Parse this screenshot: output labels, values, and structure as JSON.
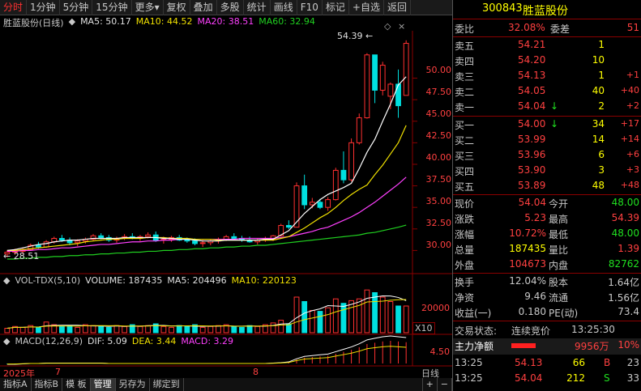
{
  "toolbar": {
    "items": [
      "分时",
      "1分钟",
      "5分钟",
      "15分钟",
      "更多",
      "复权",
      "叠加",
      "多股",
      "统计",
      "画线",
      "F10",
      "标记",
      "+自选",
      "返回"
    ],
    "more_arrow": "▾"
  },
  "chart_header": {
    "stock_name": "胜蓝股份(日线)",
    "ma5_label": "MA5: 50.17",
    "ma10_label": "MA10: 44.52",
    "ma20_label": "MA20: 38.51",
    "ma60_label": "MA60: 32.94"
  },
  "price_axis": [
    "50.00",
    "47.50",
    "45.00",
    "42.50",
    "40.00",
    "37.50",
    "35.00",
    "32.50",
    "30.00"
  ],
  "annotations": {
    "high": "54.39",
    "low": "28.51"
  },
  "volume_header": {
    "indicator": "VOL-TDX(5,10)",
    "volume": "VOLUME: 187435",
    "ma5": "MA5: 204496",
    "ma10": "MA10: 220123"
  },
  "volume_axis": [
    "20000"
  ],
  "volume_unit": "X10",
  "macd_header": {
    "indicator": "MACD(12,26,9)",
    "dif": "DIF: 5.09",
    "dea": "DEA: 3.44",
    "macd": "MACD: 3.29"
  },
  "macd_axis": [
    "4.50"
  ],
  "time_axis": {
    "year": "2025年",
    "m7": "7",
    "m8": "8",
    "period": "日线"
  },
  "bottom_tabs": [
    "指标A",
    "指标B",
    "模 板",
    "管理",
    "另存为",
    "绑定到"
  ],
  "bottom_controls": [
    "+",
    "−"
  ],
  "quote": {
    "code": "300843",
    "name": "胜蓝股份",
    "weibi_label": "委比",
    "weibi_value": "32.08%",
    "weicha_label": "委差",
    "weicha_value": "51",
    "asks": [
      {
        "label": "卖五",
        "price": "54.21",
        "vol": "1",
        "chg": ""
      },
      {
        "label": "卖四",
        "price": "54.20",
        "vol": "10",
        "chg": ""
      },
      {
        "label": "卖三",
        "price": "54.13",
        "vol": "1",
        "chg": "+1"
      },
      {
        "label": "卖二",
        "price": "54.05",
        "vol": "40",
        "chg": "+40"
      },
      {
        "label": "卖一",
        "price": "54.04",
        "vol": "2",
        "chg": "+2"
      }
    ],
    "bids": [
      {
        "label": "买一",
        "price": "54.00",
        "vol": "34",
        "chg": "+17"
      },
      {
        "label": "买二",
        "price": "53.99",
        "vol": "14",
        "chg": "+14"
      },
      {
        "label": "买三",
        "price": "53.96",
        "vol": "6",
        "chg": "+6"
      },
      {
        "label": "买四",
        "price": "53.90",
        "vol": "3",
        "chg": "+3"
      },
      {
        "label": "买五",
        "price": "53.89",
        "vol": "48",
        "chg": "+48"
      }
    ],
    "stats": [
      {
        "l1": "现价",
        "v1": "54.04",
        "l2": "今开",
        "v2": "48.00"
      },
      {
        "l1": "涨跌",
        "v1": "5.23",
        "l2": "最高",
        "v2": "54.39"
      },
      {
        "l1": "涨幅",
        "v1": "10.72%",
        "l2": "最低",
        "v2": "48.00"
      },
      {
        "l1": "总量",
        "v1": "187435",
        "l2": "量比",
        "v2": "1.39"
      },
      {
        "l1": "外盘",
        "v1": "104673",
        "l2": "内盘",
        "v2": "82762"
      }
    ],
    "stats2": [
      {
        "l1": "换手",
        "v1": "12.04%",
        "l2": "股本",
        "v2": "1.64亿"
      },
      {
        "l1": "净资",
        "v1": "9.46",
        "l2": "流通",
        "v2": "1.56亿"
      },
      {
        "l1": "收益(一)",
        "v1": "0.180",
        "l2": "PE(动)",
        "v2": "73.4"
      }
    ],
    "trade_status_label": "交易状态:",
    "trade_status": "连续竞价",
    "trade_time": "13:25:30",
    "main_flow_label": "主力净额",
    "main_flow_value": "9956万",
    "main_flow_pct": "10%",
    "ticks": [
      {
        "time": "13:25",
        "price": "54.13",
        "vol": "66",
        "side": "B",
        "n": "23"
      },
      {
        "time": "13:25",
        "price": "54.04",
        "vol": "212",
        "side": "S",
        "n": "33"
      }
    ]
  },
  "chart_data": {
    "type": "candlestick",
    "ylim": [
      27.5,
      55.5
    ],
    "candles": [
      [
        29.6,
        30.0,
        29.2,
        29.8
      ],
      [
        29.8,
        30.2,
        29.5,
        29.9
      ],
      [
        29.9,
        30.3,
        29.6,
        30.1
      ],
      [
        30.1,
        30.8,
        30.0,
        30.6
      ],
      [
        30.6,
        31.0,
        30.2,
        30.4
      ],
      [
        30.4,
        31.2,
        30.3,
        31.0
      ],
      [
        31.0,
        31.6,
        30.8,
        31.4
      ],
      [
        31.4,
        31.8,
        31.0,
        31.2
      ],
      [
        31.2,
        31.5,
        30.6,
        30.9
      ],
      [
        30.9,
        31.3,
        30.5,
        31.1
      ],
      [
        31.1,
        31.5,
        30.8,
        31.3
      ],
      [
        31.3,
        31.9,
        31.1,
        31.7
      ],
      [
        31.7,
        32.0,
        31.3,
        31.5
      ],
      [
        31.5,
        31.8,
        31.0,
        31.2
      ],
      [
        31.2,
        31.6,
        30.9,
        31.4
      ],
      [
        31.4,
        31.9,
        31.2,
        31.6
      ],
      [
        31.6,
        32.0,
        31.3,
        31.4
      ],
      [
        31.4,
        31.8,
        31.1,
        31.6
      ],
      [
        31.6,
        32.1,
        31.4,
        31.8
      ],
      [
        31.8,
        32.2,
        31.0,
        31.2
      ],
      [
        31.2,
        31.6,
        30.8,
        31.3
      ],
      [
        31.3,
        31.7,
        31.0,
        31.5
      ],
      [
        31.5,
        31.8,
        31.1,
        31.2
      ],
      [
        31.2,
        31.5,
        30.9,
        31.1
      ],
      [
        31.1,
        31.4,
        30.6,
        30.8
      ],
      [
        30.8,
        31.2,
        30.4,
        30.9
      ],
      [
        30.9,
        31.3,
        30.6,
        31.1
      ],
      [
        31.1,
        31.5,
        30.8,
        31.3
      ],
      [
        31.3,
        31.8,
        31.1,
        31.6
      ],
      [
        31.6,
        32.0,
        31.2,
        31.4
      ],
      [
        31.4,
        31.7,
        31.0,
        31.2
      ],
      [
        31.2,
        31.6,
        30.9,
        31.0
      ],
      [
        31.0,
        31.4,
        30.7,
        31.2
      ],
      [
        31.2,
        31.6,
        31.0,
        31.3
      ],
      [
        31.3,
        31.8,
        31.1,
        31.7
      ],
      [
        31.7,
        33.1,
        31.6,
        32.9
      ],
      [
        32.9,
        33.5,
        32.5,
        32.7
      ],
      [
        32.7,
        37.9,
        32.7,
        37.5
      ],
      [
        37.5,
        38.8,
        34.8,
        35.3
      ],
      [
        35.3,
        36.1,
        34.9,
        35.6
      ],
      [
        35.6,
        36.0,
        34.8,
        35.0
      ],
      [
        35.0,
        36.2,
        34.6,
        35.9
      ],
      [
        35.9,
        39.6,
        35.8,
        39.3
      ],
      [
        39.3,
        41.5,
        37.8,
        38.2
      ],
      [
        38.2,
        43.0,
        38.0,
        42.5
      ],
      [
        42.5,
        45.9,
        42.3,
        45.4
      ],
      [
        45.4,
        52.9,
        45.3,
        52.7
      ],
      [
        52.7,
        52.7,
        47.1,
        48.6
      ],
      [
        48.6,
        51.9,
        48.0,
        51.5
      ],
      [
        47.9,
        49.5,
        46.4,
        49.3
      ],
      [
        49.3,
        51.0,
        45.4,
        46.8
      ],
      [
        48.0,
        54.39,
        48.0,
        54.04
      ]
    ],
    "ma5": [
      30.0,
      30.1,
      30.3,
      30.5,
      30.7,
      30.8,
      31.0,
      31.1,
      31.2,
      31.2,
      31.3,
      31.4,
      31.4,
      31.4,
      31.4,
      31.5,
      31.5,
      31.5,
      31.5,
      31.5,
      31.4,
      31.4,
      31.3,
      31.3,
      31.2,
      31.1,
      31.1,
      31.1,
      31.2,
      31.2,
      31.2,
      31.2,
      31.2,
      31.3,
      31.3,
      31.8,
      32.3,
      33.3,
      34.3,
      35.1,
      35.9,
      36.5,
      36.9,
      37.3,
      37.8,
      39.5,
      41.4,
      42.9,
      45.0,
      47.0,
      49.2,
      50.17
    ],
    "ma10": [
      30.0,
      30.0,
      30.1,
      30.2,
      30.3,
      30.4,
      30.5,
      30.6,
      30.7,
      30.8,
      31.0,
      31.1,
      31.2,
      31.3,
      31.3,
      31.4,
      31.4,
      31.4,
      31.5,
      31.5,
      31.5,
      31.4,
      31.4,
      31.4,
      31.3,
      31.3,
      31.3,
      31.2,
      31.2,
      31.2,
      31.2,
      31.2,
      31.2,
      31.2,
      31.2,
      31.4,
      31.6,
      32.1,
      32.6,
      33.2,
      33.8,
      34.3,
      35.0,
      35.8,
      36.5,
      37.1,
      37.6,
      38.8,
      39.9,
      41.2,
      42.5,
      44.52
    ],
    "ma20": [
      29.9,
      29.9,
      30.0,
      30.0,
      30.1,
      30.1,
      30.2,
      30.3,
      30.3,
      30.4,
      30.5,
      30.6,
      30.7,
      30.7,
      30.8,
      30.9,
      31.0,
      31.0,
      31.1,
      31.1,
      31.2,
      31.2,
      31.3,
      31.3,
      31.3,
      31.3,
      31.3,
      31.3,
      31.3,
      31.3,
      31.4,
      31.4,
      31.4,
      31.4,
      31.4,
      31.5,
      31.6,
      31.8,
      32.0,
      32.2,
      32.5,
      32.7,
      33.1,
      33.5,
      33.9,
      34.4,
      35.0,
      35.6,
      36.3,
      37.0,
      37.7,
      38.51
    ],
    "ma60": [
      29.0,
      29.0,
      29.1,
      29.1,
      29.2,
      29.2,
      29.3,
      29.3,
      29.4,
      29.4,
      29.5,
      29.5,
      29.6,
      29.6,
      29.7,
      29.7,
      29.8,
      29.8,
      29.9,
      29.9,
      30.0,
      30.0,
      30.1,
      30.1,
      30.2,
      30.2,
      30.3,
      30.3,
      30.4,
      30.4,
      30.5,
      30.5,
      30.6,
      30.6,
      30.7,
      30.8,
      30.9,
      31.0,
      31.1,
      31.2,
      31.3,
      31.4,
      31.5,
      31.6,
      31.7,
      31.8,
      32.0,
      32.1,
      32.3,
      32.5,
      32.7,
      32.94
    ],
    "volume": [
      5,
      7,
      6,
      8,
      6,
      12,
      9,
      7,
      8,
      6,
      9,
      8,
      7,
      6,
      8,
      7,
      9,
      7,
      8,
      10,
      7,
      6,
      8,
      7,
      9,
      6,
      7,
      8,
      9,
      7,
      6,
      8,
      7,
      9,
      11,
      14,
      10,
      40,
      35,
      25,
      24,
      28,
      38,
      33,
      36,
      38,
      48,
      45,
      40,
      35,
      30,
      30
    ],
    "macd": [
      -0.1,
      -0.1,
      -0.05,
      0,
      0,
      0.05,
      0.05,
      0.05,
      0.05,
      0.05,
      0.05,
      0.05,
      0.05,
      0,
      0,
      0,
      0,
      0,
      0,
      0,
      0,
      0,
      0,
      0,
      0,
      0,
      0,
      0,
      0,
      0,
      0,
      0,
      0,
      0,
      0.05,
      0.1,
      0.2,
      0.6,
      0.9,
      1.0,
      1.1,
      1.2,
      1.5,
      1.8,
      2.1,
      2.5,
      3.0,
      3.2,
      3.4,
      3.5,
      3.4,
      3.29
    ]
  }
}
